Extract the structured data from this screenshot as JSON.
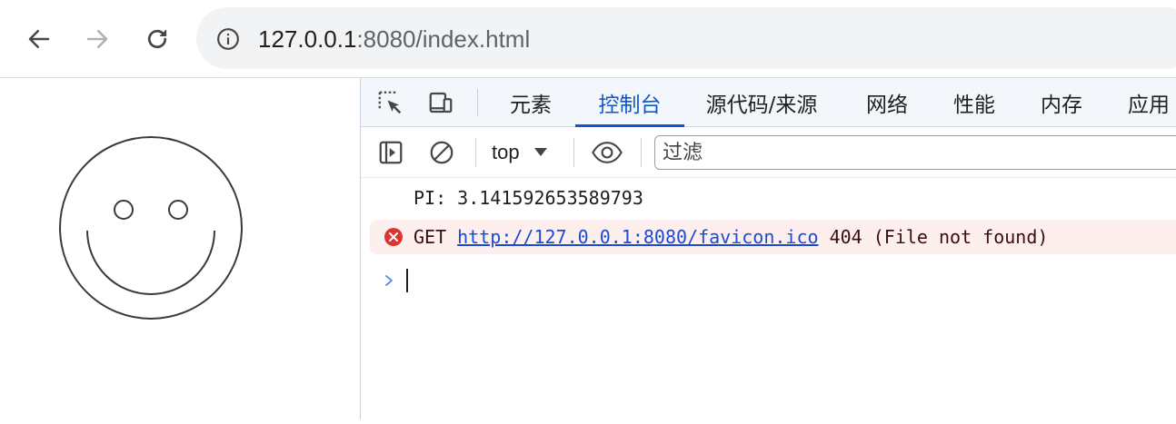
{
  "browser": {
    "url_host": "127.0.0.1",
    "url_rest": ":8080/index.html",
    "icons": [
      "back-icon",
      "forward-icon",
      "reload-icon",
      "site-info-icon"
    ]
  },
  "page": {
    "drawing": "smiley-face"
  },
  "devtools": {
    "tabs": [
      {
        "label": "元素",
        "active": false
      },
      {
        "label": "控制台",
        "active": true
      },
      {
        "label": "源代码/来源",
        "active": false
      },
      {
        "label": "网络",
        "active": false
      },
      {
        "label": "性能",
        "active": false
      },
      {
        "label": "内存",
        "active": false
      },
      {
        "label": "应用",
        "active": false
      }
    ],
    "console_toolbar": {
      "context": "top",
      "filter_placeholder": "过滤"
    },
    "console": {
      "log_message": "PI: 3.141592653589793",
      "error": {
        "method": "GET",
        "url": "http://127.0.0.1:8080/favicon.ico",
        "status": "404 (File not found)"
      }
    },
    "colors": {
      "accent": "#0b57d0",
      "error_bg": "#fcefee",
      "error_icon": "#dc362e"
    }
  }
}
